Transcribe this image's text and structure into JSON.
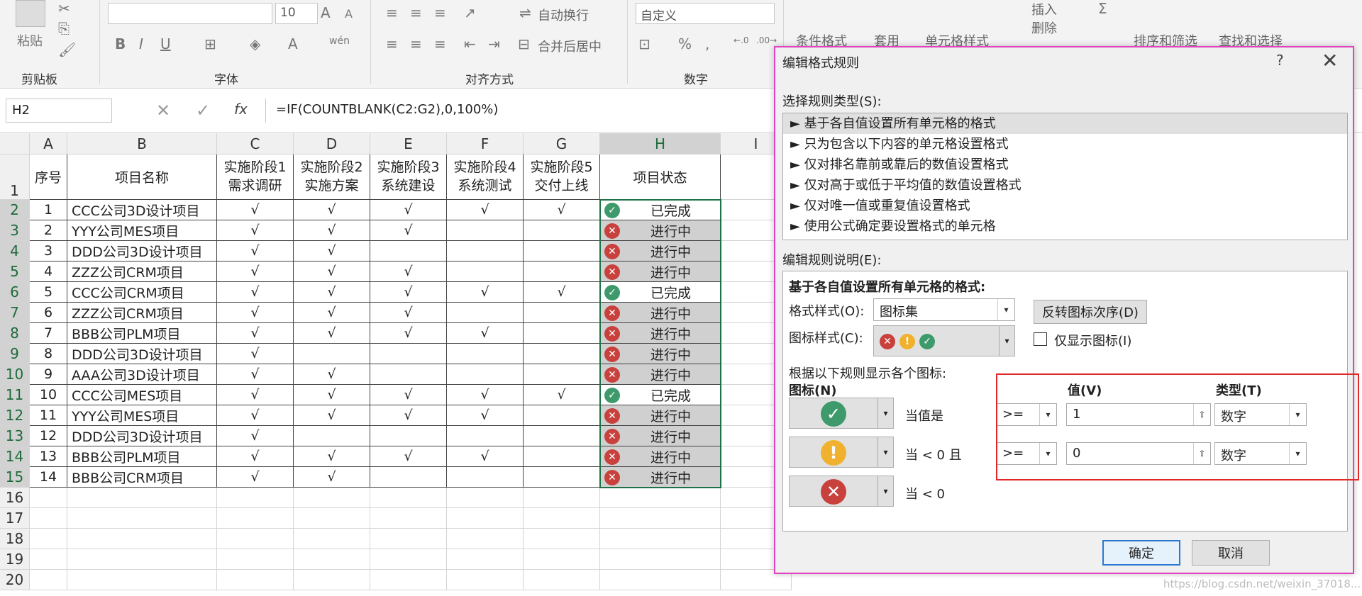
{
  "ribbon": {
    "font_size": "10",
    "font_name": "",
    "number_format": "自定义",
    "paste": "粘贴",
    "wrap_text": "自动换行",
    "merge_center": "合并后居中",
    "cond_format": "条件格式",
    "apply": "套用",
    "cell_style": "单元格样式",
    "insert": "插入",
    "delete": "删除",
    "sort_filter": "排序和筛选",
    "find_select": "查找和选择",
    "groups": [
      "剪贴板",
      "字体",
      "对齐方式",
      "数字"
    ]
  },
  "formula_bar": {
    "name_box": "H2",
    "formula": "=IF(COUNTBLANK(C2:G2),0,100%)"
  },
  "sheet": {
    "columns": [
      "A",
      "B",
      "C",
      "D",
      "E",
      "F",
      "G",
      "H",
      "I"
    ],
    "rows": [
      "1",
      "2",
      "3",
      "4",
      "5",
      "6",
      "7",
      "8",
      "9",
      "10",
      "11",
      "12",
      "13",
      "14",
      "15",
      "16",
      "17",
      "18",
      "19",
      "20"
    ],
    "header": {
      "a": "序号",
      "b": "项目名称",
      "c1": "实施阶段1",
      "c2": "需求调研",
      "d1": "实施阶段2",
      "d2": "实施方案",
      "e1": "实施阶段3",
      "e2": "系统建设",
      "f1": "实施阶段4",
      "f2": "系统测试",
      "g1": "实施阶段5",
      "g2": "交付上线",
      "h": "项目状态"
    },
    "data": [
      {
        "no": "1",
        "name": "CCC公司3D设计项目",
        "c": "√",
        "d": "√",
        "e": "√",
        "f": "√",
        "g": "√",
        "status": "已完成",
        "done": true
      },
      {
        "no": "2",
        "name": "YYY公司MES项目",
        "c": "√",
        "d": "√",
        "e": "√",
        "f": "",
        "g": "",
        "status": "进行中",
        "done": false
      },
      {
        "no": "3",
        "name": "DDD公司3D设计项目",
        "c": "√",
        "d": "√",
        "e": "",
        "f": "",
        "g": "",
        "status": "进行中",
        "done": false
      },
      {
        "no": "4",
        "name": "ZZZ公司CRM项目",
        "c": "√",
        "d": "√",
        "e": "√",
        "f": "",
        "g": "",
        "status": "进行中",
        "done": false
      },
      {
        "no": "5",
        "name": "CCC公司CRM项目",
        "c": "√",
        "d": "√",
        "e": "√",
        "f": "√",
        "g": "√",
        "status": "已完成",
        "done": true
      },
      {
        "no": "6",
        "name": "ZZZ公司CRM项目",
        "c": "√",
        "d": "√",
        "e": "√",
        "f": "",
        "g": "",
        "status": "进行中",
        "done": false
      },
      {
        "no": "7",
        "name": "BBB公司PLM项目",
        "c": "√",
        "d": "√",
        "e": "√",
        "f": "√",
        "g": "",
        "status": "进行中",
        "done": false
      },
      {
        "no": "8",
        "name": "DDD公司3D设计项目",
        "c": "√",
        "d": "",
        "e": "",
        "f": "",
        "g": "",
        "status": "进行中",
        "done": false
      },
      {
        "no": "9",
        "name": "AAA公司3D设计项目",
        "c": "√",
        "d": "√",
        "e": "",
        "f": "",
        "g": "",
        "status": "进行中",
        "done": false
      },
      {
        "no": "10",
        "name": "CCC公司MES项目",
        "c": "√",
        "d": "√",
        "e": "√",
        "f": "√",
        "g": "√",
        "status": "已完成",
        "done": true
      },
      {
        "no": "11",
        "name": "YYY公司MES项目",
        "c": "√",
        "d": "√",
        "e": "√",
        "f": "√",
        "g": "",
        "status": "进行中",
        "done": false
      },
      {
        "no": "12",
        "name": "DDD公司3D设计项目",
        "c": "√",
        "d": "",
        "e": "",
        "f": "",
        "g": "",
        "status": "进行中",
        "done": false
      },
      {
        "no": "13",
        "name": "BBB公司PLM项目",
        "c": "√",
        "d": "√",
        "e": "√",
        "f": "√",
        "g": "",
        "status": "进行中",
        "done": false
      },
      {
        "no": "14",
        "name": "BBB公司CRM项目",
        "c": "√",
        "d": "√",
        "e": "",
        "f": "",
        "g": "",
        "status": "进行中",
        "done": false
      }
    ]
  },
  "dialog": {
    "title": "编辑格式规则",
    "help": "?",
    "close": "✕",
    "rule_type_label": "选择规则类型(S):",
    "rule_types": [
      "► 基于各自值设置所有单元格的格式",
      "► 只为包含以下内容的单元格设置格式",
      "► 仅对排名靠前或靠后的数值设置格式",
      "► 仅对高于或低于平均值的数值设置格式",
      "► 仅对唯一值或重复值设置格式",
      "► 使用公式确定要设置格式的单元格"
    ],
    "rule_desc_label": "编辑规则说明(E):",
    "desc_title": "基于各自值设置所有单元格的格式:",
    "format_style_label": "格式样式(O):",
    "format_style_value": "图标集",
    "reverse_button": "反转图标次序(D)",
    "icon_style_label": "图标样式(C):",
    "show_icon_only": "仅显示图标(I)",
    "display_rule_label": "根据以下规则显示各个图标:",
    "col_icon": "图标(N)",
    "col_value": "值(V)",
    "col_type": "类型(T)",
    "rows": [
      {
        "when": "当值是",
        "op": ">=",
        "value": "1",
        "type": "数字"
      },
      {
        "when": "当 < 0 且",
        "op": ">=",
        "value": "0",
        "type": "数字"
      },
      {
        "when": "当 < 0"
      }
    ],
    "ok": "确定",
    "cancel": "取消"
  },
  "colors": {
    "green": "#3f9a6b",
    "yellow": "#f0b22e",
    "red": "#c8413c",
    "accent": "#e042c0"
  },
  "watermark": "https://blog.csdn.net/weixin_37018..."
}
